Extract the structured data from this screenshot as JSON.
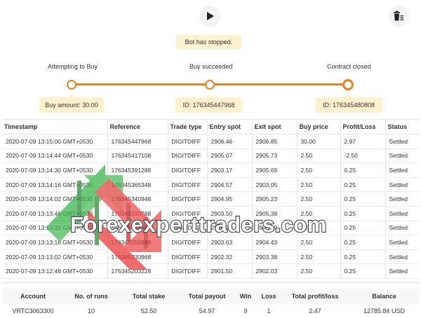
{
  "controls": {
    "play_icon": "play-icon",
    "clear_icon": "clear-list-icon"
  },
  "status_message": "Bot has stopped.",
  "steps": [
    {
      "label": "Attempting to Buy",
      "detail": "Buy amount: 30.00"
    },
    {
      "label": "Buy succeeded",
      "detail": "ID: 176345447968"
    },
    {
      "label": "Contract closed",
      "detail": "ID: 176345480808"
    }
  ],
  "transactions": {
    "columns": [
      "Timestamp",
      "Reference",
      "Trade type",
      "Entry spot",
      "Exit spot",
      "Buy price",
      "Profit/Loss",
      "Status"
    ],
    "rows": [
      {
        "timestamp": "2020-07-09 13:15:00 GMT+0530",
        "reference": "176345447968",
        "trade_type": "DIGITDIFF",
        "entry": "2906.46",
        "exit": "2906.85",
        "buy": "30.00",
        "pl": "2.97",
        "status": "Settled"
      },
      {
        "timestamp": "2020-07-09 13:14:44 GMT+0530",
        "reference": "176345417108",
        "trade_type": "DIGITDIFF",
        "entry": "2905.07",
        "exit": "2905.73",
        "buy": "2.50",
        "pl": "-2.50",
        "status": "Settled"
      },
      {
        "timestamp": "2020-07-09 13:14:30 GMT+0530",
        "reference": "176345391288",
        "trade_type": "DIGITDIFF",
        "entry": "2903.17",
        "exit": "2905.69",
        "buy": "2.50",
        "pl": "0.25",
        "status": "Settled"
      },
      {
        "timestamp": "2020-07-09 13:14:16 GMT+0530",
        "reference": "176345365348",
        "trade_type": "DIGITDIFF",
        "entry": "2904.57",
        "exit": "2903.05",
        "buy": "2.50",
        "pl": "0.25",
        "status": "Settled"
      },
      {
        "timestamp": "2020-07-09 13:14:02 GMT+0530",
        "reference": "176345340948",
        "trade_type": "DIGITDIFF",
        "entry": "2904.95",
        "exit": "2905.23",
        "buy": "2.50",
        "pl": "0.25",
        "status": "Settled"
      },
      {
        "timestamp": "2020-07-09 13:13:46 GMT+0530",
        "reference": "176345310788",
        "trade_type": "DIGITDIFF",
        "entry": "2903.50",
        "exit": "2905.38",
        "buy": "2.50",
        "pl": "0.25",
        "status": "Settled"
      },
      {
        "timestamp": "2020-07-09 13:13:32 GMT+0530",
        "reference": "176345285468",
        "trade_type": "DIGITDIFF",
        "entry": "2900.70",
        "exit": "2903.19",
        "buy": "2.50",
        "pl": "0.25",
        "status": "Settled"
      },
      {
        "timestamp": "2020-07-09 13:13:16 GMT+0530",
        "reference": "176345256868",
        "trade_type": "DIGITDIFF",
        "entry": "2903.63",
        "exit": "2904.43",
        "buy": "2.50",
        "pl": "0.25",
        "status": "Settled"
      },
      {
        "timestamp": "2020-07-09 13:13:02 GMT+0530",
        "reference": "176345230868",
        "trade_type": "DIGITDIFF",
        "entry": "2902.32",
        "exit": "2903.38",
        "buy": "2.50",
        "pl": "0.25",
        "status": "Settled"
      },
      {
        "timestamp": "2020-07-09 13:12:48 GMT+0530",
        "reference": "176345203228",
        "trade_type": "DIGITDIFF",
        "entry": "2901.50",
        "exit": "2902.03",
        "buy": "2.50",
        "pl": "0.25",
        "status": "Settled"
      }
    ]
  },
  "summary": {
    "columns": [
      "Account",
      "No. of runs",
      "Total stake",
      "Total payout",
      "Win",
      "Loss",
      "Total profit/loss",
      "Balance"
    ],
    "values": [
      "VRTC3063300",
      "10",
      "52.50",
      "54.97",
      "9",
      "1",
      "2.47",
      "12785.84 USD"
    ]
  },
  "watermark": "Forexexperttraders.com",
  "colors": {
    "accent": "#e98024",
    "pill": "#fdf1cf",
    "profit": "#39a844",
    "loss": "#e12b2b"
  }
}
